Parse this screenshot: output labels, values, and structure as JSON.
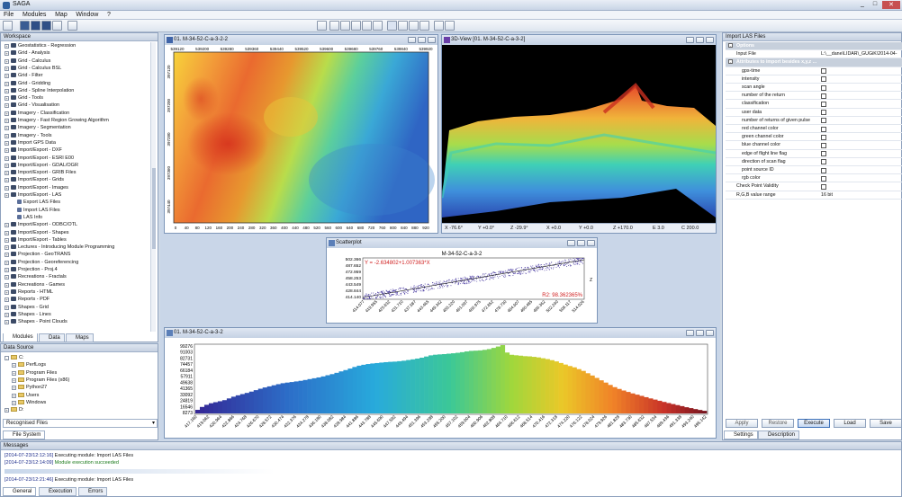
{
  "app": {
    "title": "SAGA",
    "window_buttons": [
      "_",
      "□",
      "✕"
    ]
  },
  "menu": [
    "File",
    "Modules",
    "Map",
    "Window",
    "?"
  ],
  "workspace": {
    "title": "Workspace",
    "tree": [
      "Geostatistics - Regression",
      "Grid - Analysis",
      "Grid - Calculus",
      "Grid - Calculus BSL",
      "Grid - Filter",
      "Grid - Gridding",
      "Grid - Spline Interpolation",
      "Grid - Tools",
      "Grid - Visualisation",
      "Imagery - Classification",
      "Imagery - Fast Region Growing Algorithm",
      "Imagery - Segmentation",
      "Imagery - Tools",
      "Import GPS Data",
      "Import/Export - DXF",
      "Import/Export - ESRI E00",
      "Import/Export - GDAL/OGR",
      "Import/Export - GRIB Files",
      "Import/Export - Grids",
      "Import/Export - Images",
      "Import/Export - LAS"
    ],
    "las_children": [
      "Export LAS Files",
      "Import LAS Files",
      "LAS Info"
    ],
    "tree_after": [
      "Import/Export - ODBC/OTL",
      "Import/Export - Shapes",
      "Import/Export - Tables",
      "Lectures - Introducing Module Programming",
      "Projection - GeoTRANS",
      "Projection - Georeferencing",
      "Projection - Proj.4",
      "Recreations - Fractals",
      "Recreations - Games",
      "Reports - HTML",
      "Reports - PDF",
      "Shapes - Grid",
      "Shapes - Lines",
      "Shapes - Point Clouds"
    ],
    "tabs": [
      "Modules",
      "Data",
      "Maps"
    ]
  },
  "data_source": {
    "title": "Data Source",
    "tree": [
      "C:",
      "PerfLogs",
      "Program Files",
      "Program Files (x86)",
      "Python27",
      "Users",
      "Windows",
      "D:"
    ],
    "combo": "Recognised Files",
    "tab": "File System"
  },
  "map_window": {
    "title": "01. M-34-52-C-a-3-2-2",
    "top_ticks": [
      "539120",
      "539200",
      "539280",
      "539360",
      "539440",
      "539520",
      "539600",
      "539680",
      "539760",
      "539840",
      "539920"
    ],
    "left_ticks": [
      "397120",
      "397200",
      "397280",
      "397360",
      "397440"
    ],
    "bottom_ticks": [
      "0",
      "40",
      "80",
      "120",
      "160",
      "200",
      "240",
      "280",
      "320",
      "360",
      "400",
      "440",
      "480",
      "520",
      "560",
      "600",
      "640",
      "680",
      "720",
      "760",
      "800",
      "840",
      "880",
      "920"
    ]
  },
  "view3d": {
    "title": "3D-View [01. M-34-52-C-a-3-2]",
    "status": [
      "X -76.6°",
      "Y +0.0°",
      "Z -29.9°",
      "X +0.0",
      "Y +0.0",
      "Z +170.0",
      "E 3.0",
      "C 200.0"
    ]
  },
  "scatter": {
    "title": "Scatterplot",
    "plot_title": "M-34-52-C-a-3-2",
    "equation": "Y = -2.634802+1.007363*X",
    "r2": "R2: 98.362365%",
    "yticks": [
      "502.366",
      "487.652",
      "472.959",
      "458.253",
      "443.549",
      "428.844",
      "414.140"
    ],
    "xticks": [
      "414.077",
      "419.955",
      "425.832",
      "431.710",
      "437.587",
      "443.465",
      "449.342",
      "455.220",
      "461.097",
      "466.975",
      "472.852",
      "478.730",
      "484.607",
      "490.485",
      "496.362",
      "502.240",
      "508.117",
      "514.026"
    ],
    "ylabel": "Z"
  },
  "histogram": {
    "title": "01. M-34-52-C-a-3-2",
    "yticks": [
      "99276",
      "91003",
      "82731",
      "74457",
      "66184",
      "57911",
      "49638",
      "41365",
      "33092",
      "24819",
      "16546",
      "8273"
    ],
    "xticks": [
      "417.160",
      "419.062",
      "420.964",
      "422.866",
      "424.768",
      "426.670",
      "428.572",
      "430.474",
      "432.376",
      "434.278",
      "436.180",
      "438.082",
      "439.984",
      "441.886",
      "443.788",
      "445.690",
      "447.592",
      "449.494",
      "451.396",
      "453.298",
      "455.200",
      "457.102",
      "459.004",
      "460.906",
      "462.808",
      "464.710",
      "466.612",
      "468.514",
      "470.416",
      "472.318",
      "474.220",
      "476.122",
      "478.024",
      "479.926",
      "481.828",
      "483.730",
      "485.632",
      "487.534",
      "489.436",
      "491.338",
      "493.240",
      "495.142"
    ]
  },
  "chart_data": {
    "type": "bar",
    "title": "01. M-34-52-C-a-3-2",
    "xlabel": "",
    "ylabel": "",
    "ylim": [
      0,
      99276
    ],
    "categories_range": [
      417.16,
      498.6
    ],
    "values": [
      5200,
      9400,
      12500,
      14800,
      16300,
      17700,
      19300,
      21800,
      24300,
      26300,
      28100,
      29800,
      31700,
      33800,
      35900,
      37700,
      39300,
      40900,
      42500,
      43900,
      44800,
      45600,
      46500,
      47400,
      48600,
      49900,
      51100,
      52300,
      53800,
      55500,
      57100,
      59000,
      61100,
      63000,
      65200,
      67500,
      69400,
      70700,
      71800,
      72600,
      73200,
      73900,
      74500,
      75000,
      75300,
      75900,
      76600,
      77600,
      78600,
      79700,
      81000,
      82700,
      84400,
      85300,
      85800,
      86200,
      86800,
      87400,
      88100,
      89000,
      90100,
      90900,
      91200,
      91600,
      92400,
      93500,
      95200,
      97200,
      99276,
      88500,
      85200,
      84500,
      83900,
      83200,
      82900,
      82200,
      81400,
      80200,
      79000,
      77400,
      75600,
      73300,
      71000,
      68900,
      67000,
      64400,
      61800,
      58400,
      55100,
      51600,
      48100,
      44800,
      41400,
      38200,
      35600,
      33300,
      31200,
      29100,
      27300,
      25500,
      23600,
      21800,
      20100,
      18400,
      16700,
      15100,
      13600,
      12100,
      10600,
      9000,
      7700,
      6300,
      5000,
      3800
    ]
  },
  "properties": {
    "title": "Import LAS Files",
    "section_options": "Options",
    "input_file_label": "Input File",
    "input_file_value": "L:\\__dane\\LIDAR\\_GUGiK\\2014-04-10",
    "section_attrs": "Attributes to import besides x,y,z ...",
    "attrs": [
      "gps-time",
      "intensity",
      "scan angle",
      "number of the return",
      "classification",
      "user data",
      "number of returns of given pulse",
      "red channel color",
      "green channel color",
      "blue channel color",
      "edge of flight line flag",
      "direction of scan flag",
      "point source ID",
      "rgb color"
    ],
    "check_point_validity": "Check Point Validity",
    "rgb_range_label": "R,G,B value range",
    "rgb_range_value": "16 bit",
    "buttons": [
      "Apply",
      "Restore",
      "Execute",
      "Load",
      "Save"
    ],
    "tabs": [
      "Settings",
      "Description"
    ]
  },
  "messages": {
    "title": "Messages",
    "lines": [
      {
        "time": "[2014-07-23/12:12:16]",
        "text": "Executing module: Import LAS Files"
      },
      {
        "time": "[2014-07-23/12:14:09]",
        "text": "Module execution succeeded"
      },
      {
        "time": "[2014-07-23/12:21:46]",
        "text": "Executing module: Import LAS Files"
      }
    ],
    "tabs": [
      "General",
      "Execution",
      "Errors"
    ]
  }
}
